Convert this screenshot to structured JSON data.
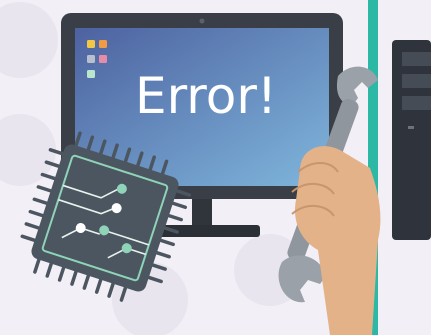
{
  "screen": {
    "message": "Error!"
  },
  "colors": {
    "background": "#f2eff6",
    "screen_gradient_start": "#4d6aa8",
    "screen_gradient_end": "#7aaed8",
    "monitor_frame": "#3a3f47",
    "chip_body": "#4c5660",
    "chip_trace": "#8fd3b8",
    "wrench": "#9aa1a8",
    "hand_skin": "#e3b289",
    "teal_panel": "#2bb8a4"
  },
  "icons": [
    "monitor-icon",
    "app-grid-icon",
    "cpu-chip-icon",
    "wrench-icon",
    "hand-icon",
    "server-tower-icon"
  ]
}
